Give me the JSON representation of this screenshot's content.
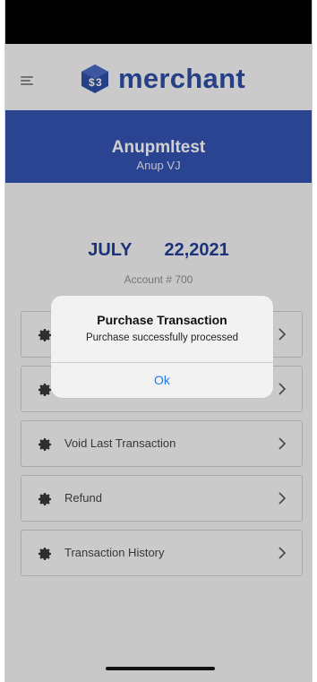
{
  "app": {
    "logo_text": "merchant"
  },
  "header": {
    "menu_icon": "hamburger-icon",
    "logo_icon": "merchant-cube-logo-icon"
  },
  "banner": {
    "name": "Anupmltest",
    "sub": "Anup VJ"
  },
  "date": {
    "month": "JULY",
    "day_year": "22,2021",
    "account": "Account # 700"
  },
  "menu": {
    "items": [
      {
        "label": "",
        "icon": "gear-icon"
      },
      {
        "label": "",
        "icon": "gear-icon"
      },
      {
        "label": "Void Last Transaction",
        "icon": "gear-icon"
      },
      {
        "label": "Refund",
        "icon": "gear-icon"
      },
      {
        "label": "Transaction History",
        "icon": "gear-icon"
      }
    ]
  },
  "dialog": {
    "title": "Purchase Transaction",
    "message": "Purchase successfully processed",
    "ok_label": "Ok"
  },
  "colors": {
    "brand_blue": "#2f4fa5",
    "banner_blue": "#3553b3",
    "date_blue": "#233f97",
    "ios_link_blue": "#1a7bf2"
  }
}
